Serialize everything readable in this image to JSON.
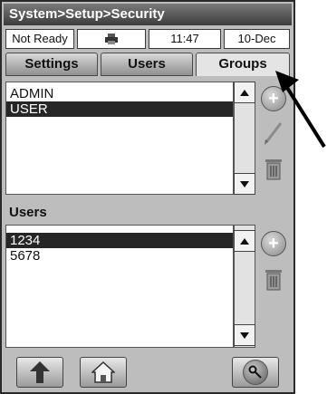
{
  "titlebar": {
    "title": "System>Setup>Security"
  },
  "status": {
    "state": "Not Ready",
    "time": "11:47",
    "date": "10-Dec"
  },
  "tabs": [
    {
      "label": "Settings"
    },
    {
      "label": "Users"
    },
    {
      "label": "Groups",
      "active": true
    }
  ],
  "groups": {
    "items": [
      {
        "label": "ADMIN"
      },
      {
        "label": "USER",
        "selected": true
      }
    ]
  },
  "users": {
    "section_label": "Users",
    "items": [
      {
        "label": "1234",
        "selected": true
      },
      {
        "label": "5678"
      }
    ]
  },
  "icons": {
    "status_icon": "printer-icon",
    "add": "add-icon",
    "edit": "pencil-icon",
    "delete": "trash-icon",
    "scroll_up": "arrow-up-icon",
    "scroll_down": "arrow-down-icon",
    "back": "up-arrow-icon",
    "home": "home-icon",
    "key": "key-icon",
    "pointer": "pointer-arrow-icon"
  },
  "colors": {
    "titlebar": "#3c3c3c",
    "selection": "#262626",
    "frame": "#bdbdbd"
  }
}
